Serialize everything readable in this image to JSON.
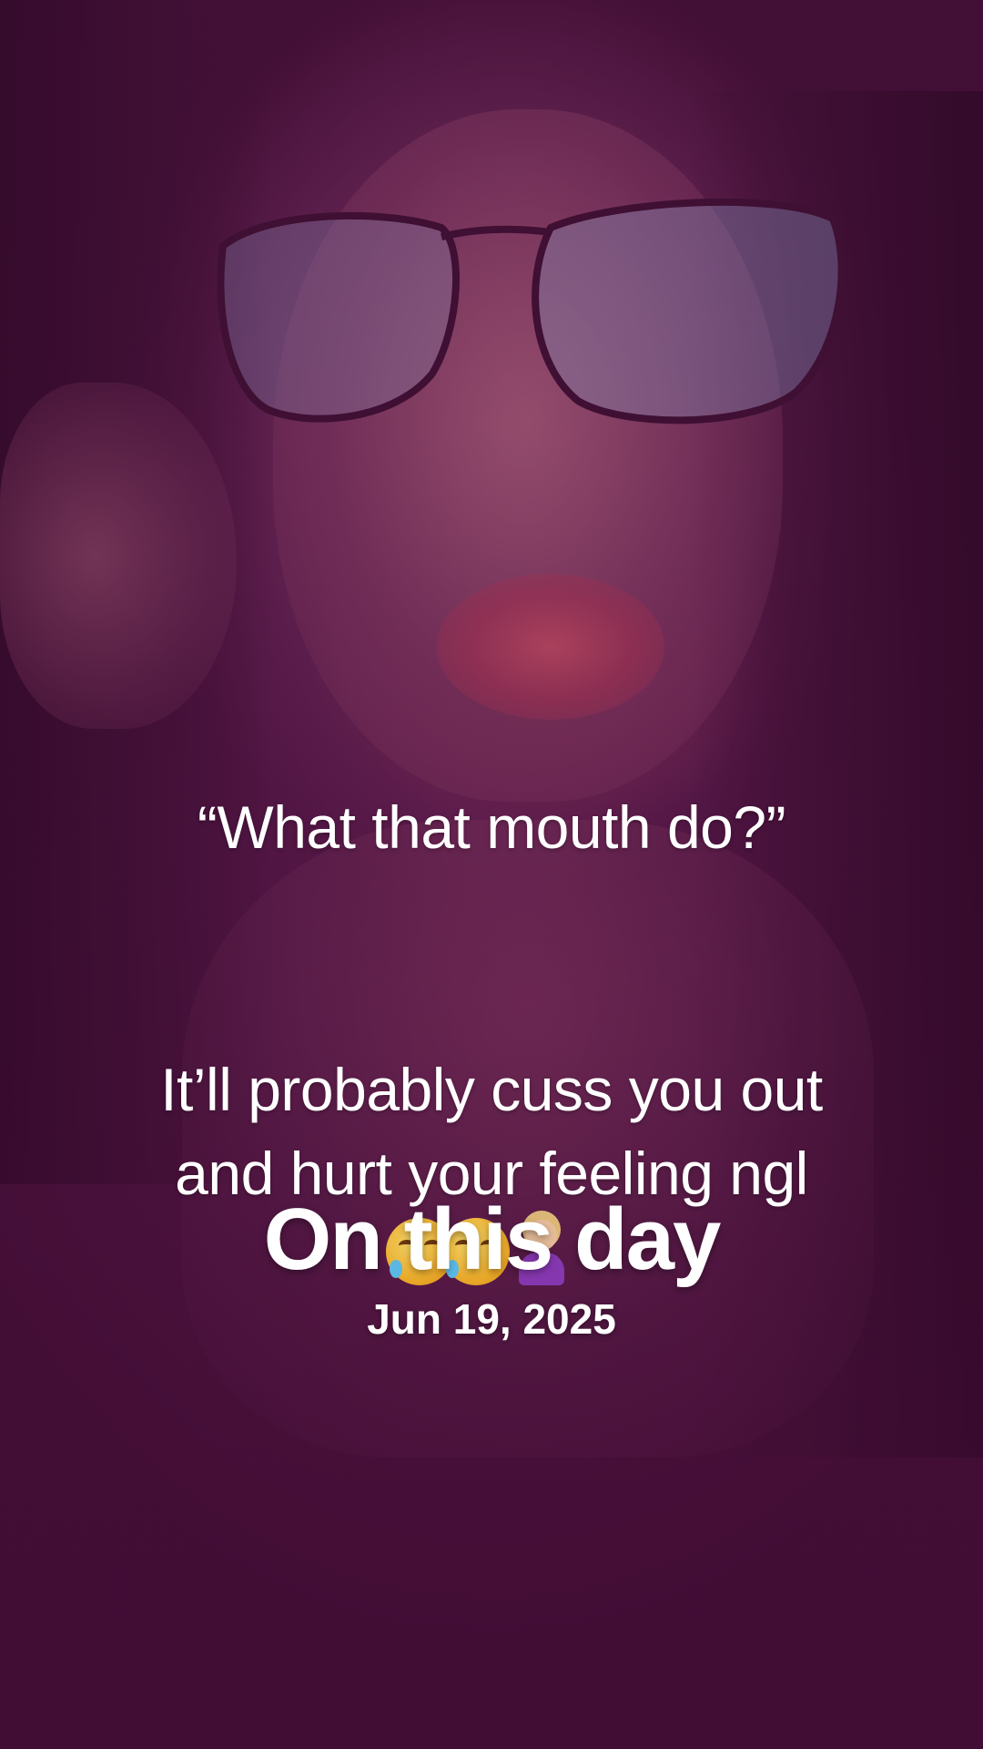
{
  "caption": {
    "quote": "“What that mouth do?”",
    "reply_lines": [
      "It’ll probably cuss you out",
      "and hurt your feeling ngl"
    ]
  },
  "memory": {
    "title": "On this day",
    "date": "Jun 19, 2025"
  },
  "emojis": [
    "face-with-tears-of-joy-icon",
    "face-with-tears-of-joy-icon",
    "person-shrugging-icon"
  ],
  "colors": {
    "background": "#3e0e33",
    "text": "#ffffff"
  }
}
